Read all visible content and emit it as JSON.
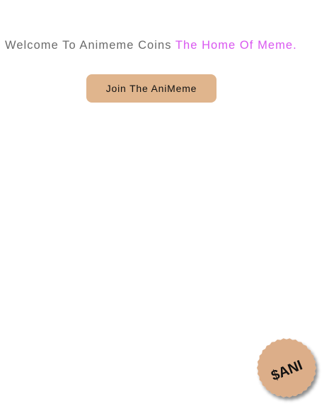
{
  "colors": {
    "text_gray": "#6b6b6b",
    "accent": "#d957f0",
    "button_bg": "#e0b58d",
    "badge_bg": "#dcae89"
  },
  "hero": {
    "welcome_text": "Welcome To Animeme Coins",
    "tagline": "The Home Of Meme."
  },
  "join_button": {
    "label": "Join The AniMeme"
  },
  "badge": {
    "label": "$ANI"
  }
}
